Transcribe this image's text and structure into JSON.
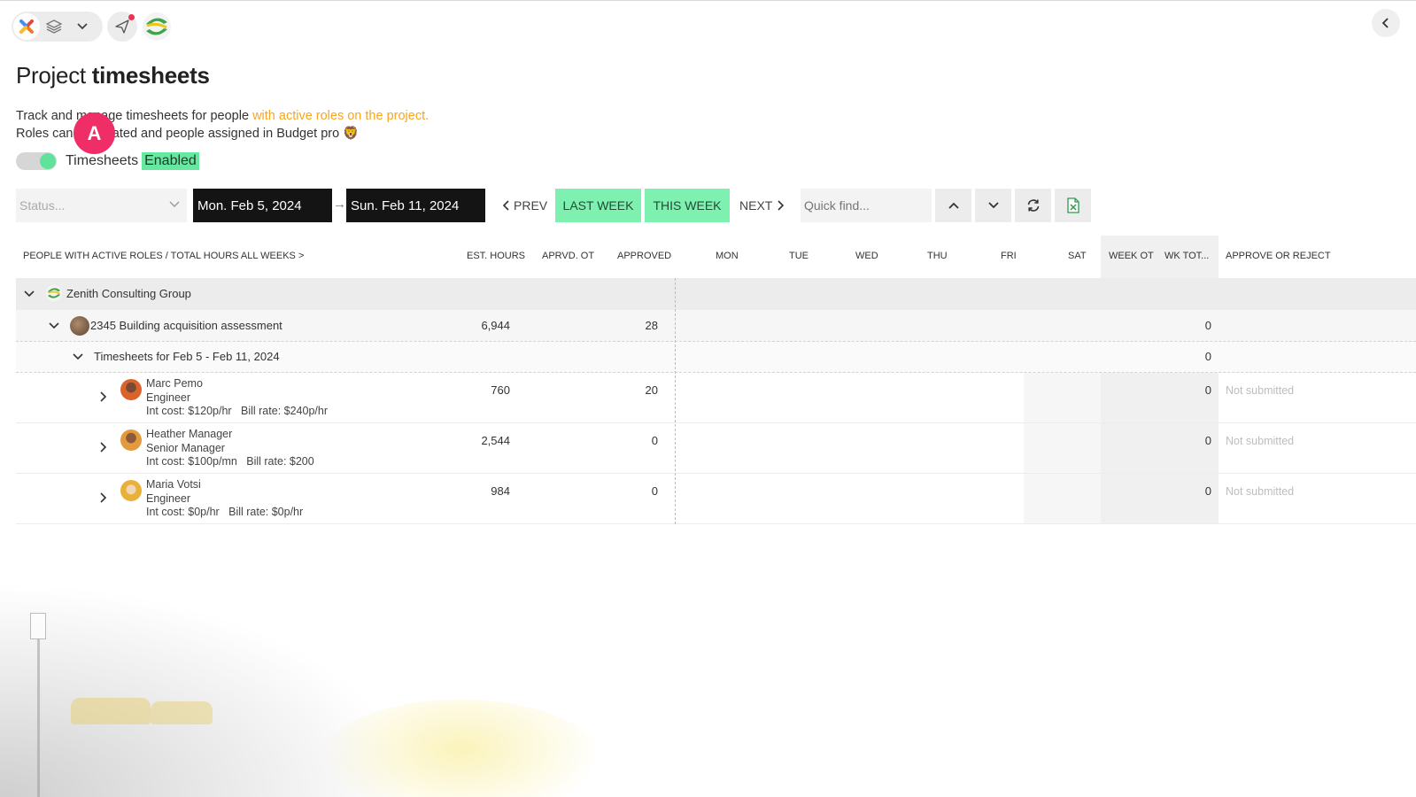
{
  "page": {
    "title_prefix": "Project",
    "title_bold": "timesheets",
    "desc_line1_a": "Track and manage timesheets for people",
    "desc_line1_b": "with active roles on the project.",
    "desc_line2": "Roles can be created and people assigned in Budget pro 🦁",
    "marker": "A",
    "timesheets_label": "Timesheets",
    "timesheets_state": "Enabled"
  },
  "filters": {
    "status_placeholder": "Status...",
    "date_from": "Mon. Feb 5, 2024",
    "date_arrow": "→",
    "date_to": "Sun. Feb 11, 2024",
    "prev": "PREV",
    "last_week": "LAST WEEK",
    "this_week": "THIS WEEK",
    "next": "NEXT",
    "quick_find_placeholder": "Quick find..."
  },
  "table": {
    "headers": {
      "people": "PEOPLE WITH ACTIVE ROLES / TOTAL HOURS ALL WEEKS >",
      "est": "EST. HOURS",
      "aprvd_ot": "APRVD. OT",
      "approved": "APPROVED",
      "mon": "MON",
      "tue": "TUE",
      "wed": "WED",
      "thu": "THU",
      "fri": "FRI",
      "sat": "SAT",
      "week_ot": "WEEK OT",
      "wk_tot": "WK TOT...",
      "approve": "APPROVE OR REJECT"
    },
    "group": {
      "name": "Zenith Consulting Group"
    },
    "project": {
      "name": "2345 Building acquisition assessment",
      "est": "6,944",
      "approved": "28",
      "wk_tot": "0"
    },
    "period": {
      "name": "Timesheets for Feb 5 - Feb 11, 2024",
      "wk_tot": "0"
    },
    "people": [
      {
        "name": "Marc Pemo",
        "role": "Engineer",
        "rates": "Int cost: $120p/hr   Bill rate: $240p/hr",
        "est": "760",
        "approved": "20",
        "wk_tot": "0",
        "status": "Not submitted",
        "avatar_color": "#d9632b"
      },
      {
        "name": "Heather Manager",
        "role": "Senior Manager",
        "rates": "Int cost: $100p/mn   Bill rate: $200",
        "est": "2,544",
        "approved": "0",
        "wk_tot": "0",
        "status": "Not submitted",
        "avatar_color": "#e29a3c"
      },
      {
        "name": "Maria Votsi",
        "role": "Engineer",
        "rates": "Int cost: $0p/hr   Bill rate: $0p/hr",
        "est": "984",
        "approved": "0",
        "wk_tot": "0",
        "status": "Not submitted",
        "avatar_color": "#e8b23a"
      }
    ]
  },
  "colors": {
    "accent_green": "#7ef0b0",
    "highlight_orange": "#f5a623",
    "marker_pink": "#ef2d67",
    "dark_date": "#141414"
  }
}
